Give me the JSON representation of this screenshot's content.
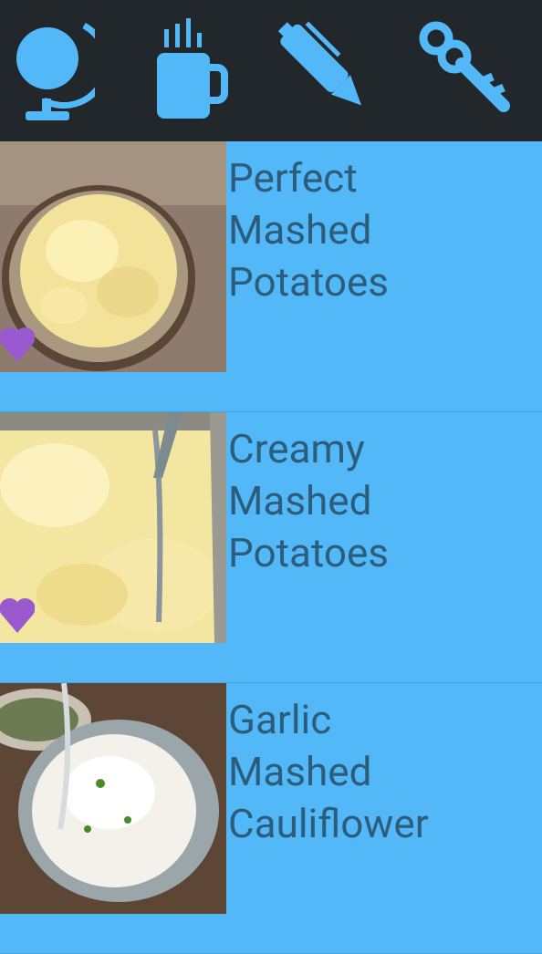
{
  "toolbar": {
    "icons": [
      "globe-icon",
      "mug-icon",
      "pen-icon",
      "key-icon"
    ],
    "background": "#22272b",
    "icon_color": "#53b8f7"
  },
  "recipes": [
    {
      "title_lines": [
        "Perfect",
        "Mashed",
        "Potatoes"
      ],
      "favorite": true
    },
    {
      "title_lines": [
        "Creamy",
        "Mashed",
        "Potatoes"
      ],
      "favorite": true
    },
    {
      "title_lines": [
        "Garlic",
        "Mashed",
        "Cauliflower"
      ],
      "favorite": false
    }
  ],
  "colors": {
    "list_background": "#53b8f7",
    "title_text": "#2d5d7c",
    "heart": "#9b59d0"
  }
}
